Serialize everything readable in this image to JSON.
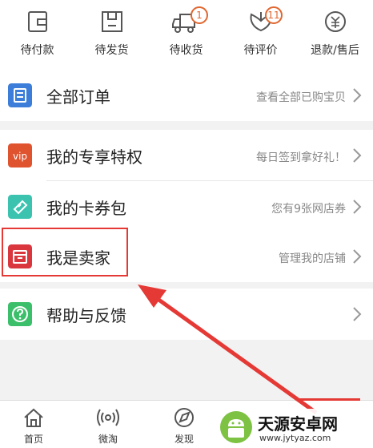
{
  "order_status": [
    {
      "label": "待付款",
      "icon": "wallet-icon"
    },
    {
      "label": "待发货",
      "icon": "package-icon"
    },
    {
      "label": "待收货",
      "icon": "truck-icon",
      "badge": "1"
    },
    {
      "label": "待评价",
      "icon": "review-icon",
      "badge": "11"
    },
    {
      "label": "退款/售后",
      "icon": "refund-icon"
    }
  ],
  "all_orders": {
    "title": "全部订单",
    "hint": "查看全部已购宝贝",
    "icon": "order-list-icon",
    "color": "#3b7dd8"
  },
  "privilege": {
    "title": "我的专享特权",
    "hint": "每日签到拿好礼！",
    "icon": "vip-icon",
    "icon_text": "vip",
    "color": "#e0532f"
  },
  "coupons": {
    "title": "我的卡券包",
    "hint": "您有9张网店券",
    "icon": "coupon-icon",
    "color": "#3cc3b0"
  },
  "seller": {
    "title": "我是卖家",
    "hint": "管理我的店铺",
    "icon": "store-icon",
    "color": "#d9363e"
  },
  "help": {
    "title": "帮助与反馈",
    "icon": "help-icon",
    "color": "#3cbf6a"
  },
  "bottom_nav": [
    {
      "label": "首页",
      "icon": "home-icon"
    },
    {
      "label": "微淘",
      "icon": "broadcast-icon"
    },
    {
      "label": "发现",
      "icon": "discover-icon"
    }
  ],
  "watermark": {
    "title": "天源安卓网",
    "url": "www.jytyaz.com"
  },
  "colors": {
    "accent": "#e53935",
    "badge": "#e0662f"
  }
}
